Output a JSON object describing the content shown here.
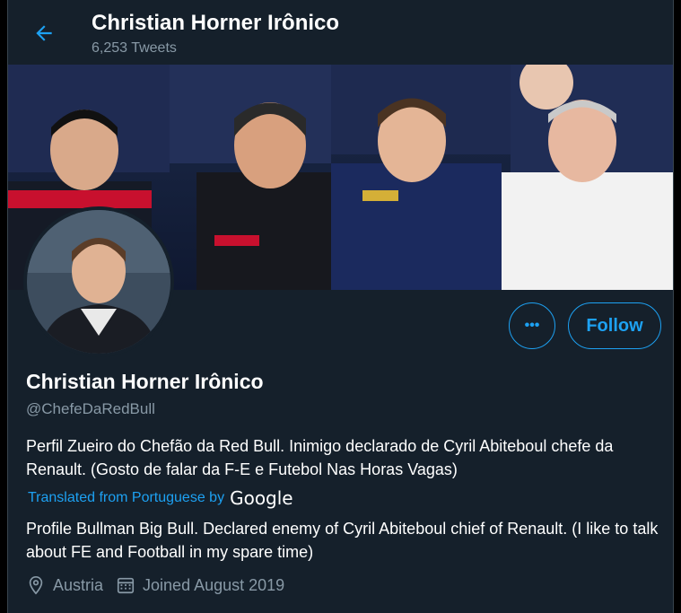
{
  "header": {
    "title": "Christian Horner Irônico",
    "tweet_count": "6,253 Tweets"
  },
  "icons": {
    "back": "arrow-left-icon",
    "more": "more-horizontal-icon",
    "location": "location-pin-icon",
    "calendar": "calendar-icon"
  },
  "actions": {
    "more_label": "•••",
    "follow_label": "Follow"
  },
  "profile": {
    "name": "Christian Horner Irônico",
    "handle": "@ChefeDaRedBull",
    "bio": "Perfil Zueiro do Chefão da Red Bull. Inimigo declarado de Cyril Abiteboul chefe da Renault. (Gosto de falar da F-E e Futebol Nas Horas Vagas)",
    "translated_label": "Translated from Portuguese by",
    "translator": "Google",
    "bio_translated": "Profile Bullman Big Bull. Declared enemy of Cyril Abiteboul chief of Renault. (I like to talk about FE and Football in my spare time)",
    "location": "Austria",
    "joined": "Joined August 2019"
  },
  "colors": {
    "background": "#15202b",
    "accent": "#1da1f2",
    "secondary_text": "#8899a6"
  }
}
